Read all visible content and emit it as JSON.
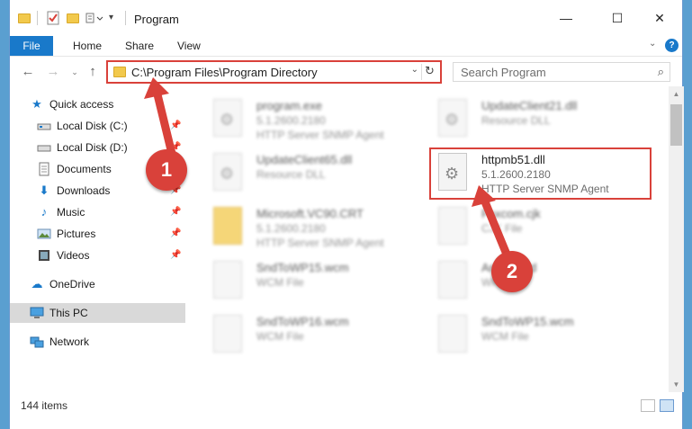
{
  "window": {
    "title": "Program",
    "controls": {
      "minimize": "—",
      "maximize": "☐",
      "close": "✕"
    }
  },
  "ribbon": {
    "tabs": [
      "File",
      "Home",
      "Share",
      "View"
    ]
  },
  "address": {
    "path": "C:\\Program Files\\Program Directory",
    "search_placeholder": "Search Program"
  },
  "nav": {
    "items": [
      {
        "label": "Quick access",
        "icon": "star-icon"
      },
      {
        "label": "Local Disk (C:)",
        "icon": "drive-icon",
        "pinned": true
      },
      {
        "label": "Local Disk (D:)",
        "icon": "drive-icon",
        "pinned": true
      },
      {
        "label": "Documents",
        "icon": "documents-icon",
        "pinned": true
      },
      {
        "label": "Downloads",
        "icon": "download-icon",
        "pinned": true
      },
      {
        "label": "Music",
        "icon": "music-icon",
        "pinned": true
      },
      {
        "label": "Pictures",
        "icon": "pictures-icon",
        "pinned": true
      },
      {
        "label": "Videos",
        "icon": "videos-icon",
        "pinned": true
      },
      {
        "label": "OneDrive",
        "icon": "cloud-icon"
      },
      {
        "label": "This PC",
        "icon": "pc-icon",
        "selected": true
      },
      {
        "label": "Network",
        "icon": "network-icon"
      }
    ]
  },
  "files": [
    {
      "name": "program.exe",
      "line2": "5.1.2600.2180",
      "line3": "HTTP Server SNMP Agent"
    },
    {
      "name": "UpdateClient21.dll",
      "line2": "Resource DLL",
      "line3": ""
    },
    {
      "name": "UpdateClient65.dll",
      "line2": "Resource DLL",
      "line3": ""
    },
    {
      "name": "httpmb51.dll",
      "line2": "5.1.2600.2180",
      "line3": "HTTP Server SNMP Agent"
    },
    {
      "name": "Microsoft.VC90.CRT",
      "line2": "5.1.2600.2180",
      "line3": "HTTP Server SNMP Agent"
    },
    {
      "name": "Faxcom.cjk",
      "line2": "CJK File",
      "line3": ""
    },
    {
      "name": "SndToWP15.wcm",
      "line2": "WCM File",
      "line3": ""
    },
    {
      "name": "Arabic.wrd",
      "line2": "WRD File",
      "line3": ""
    },
    {
      "name": "SndToWP16.wcm",
      "line2": "WCM File",
      "line3": ""
    },
    {
      "name": "SndToWP15.wcm",
      "line2": "WCM File",
      "line3": ""
    }
  ],
  "status": {
    "item_count": "144 items"
  },
  "annotations": {
    "step1": "1",
    "step2": "2"
  },
  "colors": {
    "accent": "#1979ca",
    "annotation": "#d9413a"
  }
}
